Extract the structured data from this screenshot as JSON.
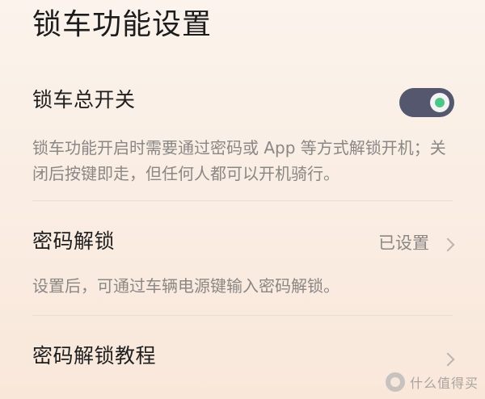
{
  "page": {
    "title": "锁车功能设置"
  },
  "lock_switch": {
    "label": "锁车总开关",
    "enabled": true,
    "description": "锁车功能开启时需要通过密码或 App 等方式解锁开机；关闭后按键即走，但任何人都可以开机骑行。"
  },
  "password_unlock": {
    "label": "密码解锁",
    "value": "已设置",
    "description": "设置后，可通过车辆电源键输入密码解锁。",
    "icon": "chevron-right-icon"
  },
  "password_tutorial": {
    "label": "密码解锁教程",
    "icon": "chevron-right-icon"
  },
  "watermark": {
    "text": "什么值得买",
    "icon": "smzdm-logo-icon"
  },
  "colors": {
    "toggle_track": "#55576e",
    "toggle_indicator": "#4cc78a",
    "secondary_text": "#8a8784"
  }
}
